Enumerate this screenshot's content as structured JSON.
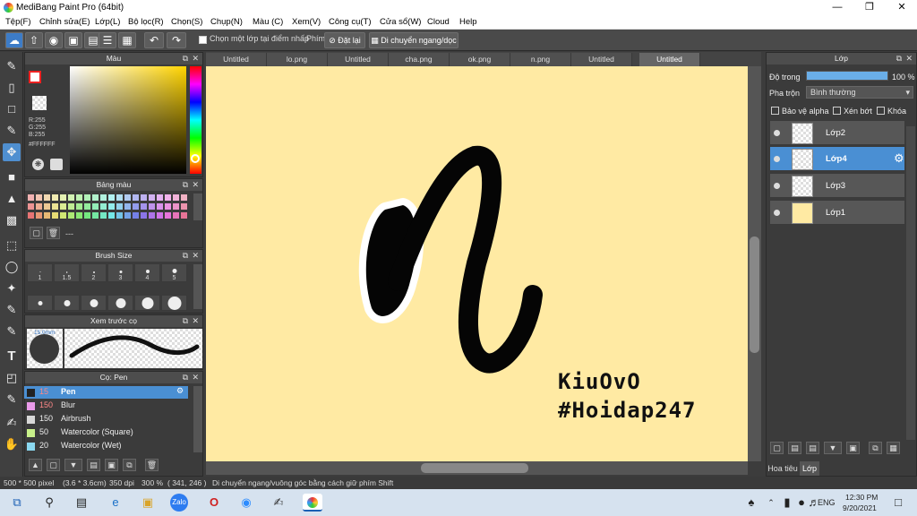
{
  "app": {
    "title": "MediBang Paint Pro (64bit)"
  },
  "menu": [
    "Tệp(F)",
    "Chỉnh sửa(E)",
    "Lớp(L)",
    "Bộ lọc(R)",
    "Chọn(S)",
    "Chụp(N)",
    "Màu (C)",
    "Xem(V)",
    "Công cụ(T)",
    "Cửa sổ(W)",
    "Cloud",
    "Help"
  ],
  "toolbar": {
    "select_layer_label": "Chọn một lớp tại điểm nhấp",
    "key_label": "Phím",
    "reset_label": "Đặt lại",
    "move_label": "Di chuyển ngang/dọc"
  },
  "color_panel": {
    "title": "Màu",
    "r": "R:255",
    "g": "G:255",
    "b": "B:255",
    "hex": "#FFFFFF"
  },
  "palette_panel": {
    "title": "Bảng màu",
    "dash": "---"
  },
  "brush_size_panel": {
    "title": "Brush Size",
    "sizes": [
      "1",
      "1.5",
      "2",
      "3",
      "4",
      "5"
    ]
  },
  "preview_panel": {
    "title": "Xem trước cọ",
    "size_label": "15.0mm"
  },
  "brush_panel": {
    "title": "Cọ: Pen",
    "brushes": [
      {
        "size": "15",
        "name": "Pen",
        "color": "#222222"
      },
      {
        "size": "150",
        "name": "Blur",
        "color": "#e99ae9"
      },
      {
        "size": "150",
        "name": "Airbrush",
        "color": "#d8d8d8"
      },
      {
        "size": "50",
        "name": "Watercolor (Square)",
        "color": "#c8f08a"
      },
      {
        "size": "20",
        "name": "Watercolor (Wet)",
        "color": "#8ad8f0"
      }
    ]
  },
  "tabs": [
    "Untitled",
    "lo.png",
    "Untitled",
    "cha.png",
    "ok.png",
    "n.png",
    "Untitled",
    "Untitled"
  ],
  "active_tab_index": 7,
  "canvas": {
    "watermark_line1": "KiuOvO",
    "watermark_line2": "#Hoidap247",
    "background": "#ffeaa3"
  },
  "layer_panel": {
    "title": "Lớp",
    "opacity_label": "Độ trong",
    "opacity_value": "100 %",
    "opacity_fraction": 1.0,
    "blend_label": "Pha trộn",
    "blend_value": "Bình thường",
    "protect_alpha": "Bảo vệ alpha",
    "clip": "Xén bớt",
    "lock": "Khóa",
    "layers": [
      "Lớp2",
      "Lớp4",
      "Lớp3",
      "Lớp1"
    ],
    "selected_layer": "Lớp4",
    "bottom_tabs": [
      "Hoa tiêu",
      "Lớp"
    ]
  },
  "status": {
    "size": "500 * 500 pixel",
    "physical": "(3.6 * 3.6cm)",
    "dpi": "350 dpi",
    "zoom": "300 %",
    "coords": "( 341, 246 )",
    "hint": "Di chuyển ngang/vuông góc bằng cách giữ phím Shift"
  },
  "taskbar": {
    "lang": "ENG",
    "time": "12:30 PM",
    "date": "9/20/2021"
  },
  "colors": {
    "accent": "#4a8fd3",
    "panel": "#3b3b3b",
    "canvas": "#ffeaa3"
  }
}
